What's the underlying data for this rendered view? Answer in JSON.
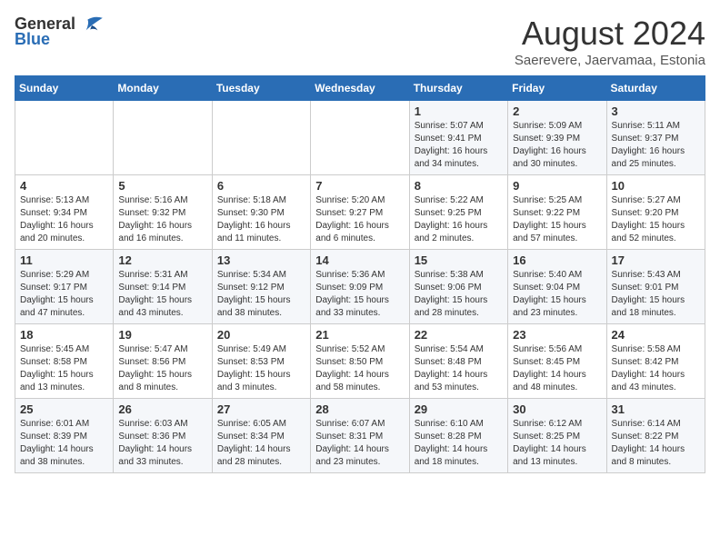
{
  "logo": {
    "general": "General",
    "blue": "Blue"
  },
  "title": {
    "month_year": "August 2024",
    "location": "Saerevere, Jaervamaa, Estonia"
  },
  "days_of_week": [
    "Sunday",
    "Monday",
    "Tuesday",
    "Wednesday",
    "Thursday",
    "Friday",
    "Saturday"
  ],
  "weeks": [
    [
      {
        "day": "",
        "info": ""
      },
      {
        "day": "",
        "info": ""
      },
      {
        "day": "",
        "info": ""
      },
      {
        "day": "",
        "info": ""
      },
      {
        "day": "1",
        "info": "Sunrise: 5:07 AM\nSunset: 9:41 PM\nDaylight: 16 hours\nand 34 minutes."
      },
      {
        "day": "2",
        "info": "Sunrise: 5:09 AM\nSunset: 9:39 PM\nDaylight: 16 hours\nand 30 minutes."
      },
      {
        "day": "3",
        "info": "Sunrise: 5:11 AM\nSunset: 9:37 PM\nDaylight: 16 hours\nand 25 minutes."
      }
    ],
    [
      {
        "day": "4",
        "info": "Sunrise: 5:13 AM\nSunset: 9:34 PM\nDaylight: 16 hours\nand 20 minutes."
      },
      {
        "day": "5",
        "info": "Sunrise: 5:16 AM\nSunset: 9:32 PM\nDaylight: 16 hours\nand 16 minutes."
      },
      {
        "day": "6",
        "info": "Sunrise: 5:18 AM\nSunset: 9:30 PM\nDaylight: 16 hours\nand 11 minutes."
      },
      {
        "day": "7",
        "info": "Sunrise: 5:20 AM\nSunset: 9:27 PM\nDaylight: 16 hours\nand 6 minutes."
      },
      {
        "day": "8",
        "info": "Sunrise: 5:22 AM\nSunset: 9:25 PM\nDaylight: 16 hours\nand 2 minutes."
      },
      {
        "day": "9",
        "info": "Sunrise: 5:25 AM\nSunset: 9:22 PM\nDaylight: 15 hours\nand 57 minutes."
      },
      {
        "day": "10",
        "info": "Sunrise: 5:27 AM\nSunset: 9:20 PM\nDaylight: 15 hours\nand 52 minutes."
      }
    ],
    [
      {
        "day": "11",
        "info": "Sunrise: 5:29 AM\nSunset: 9:17 PM\nDaylight: 15 hours\nand 47 minutes."
      },
      {
        "day": "12",
        "info": "Sunrise: 5:31 AM\nSunset: 9:14 PM\nDaylight: 15 hours\nand 43 minutes."
      },
      {
        "day": "13",
        "info": "Sunrise: 5:34 AM\nSunset: 9:12 PM\nDaylight: 15 hours\nand 38 minutes."
      },
      {
        "day": "14",
        "info": "Sunrise: 5:36 AM\nSunset: 9:09 PM\nDaylight: 15 hours\nand 33 minutes."
      },
      {
        "day": "15",
        "info": "Sunrise: 5:38 AM\nSunset: 9:06 PM\nDaylight: 15 hours\nand 28 minutes."
      },
      {
        "day": "16",
        "info": "Sunrise: 5:40 AM\nSunset: 9:04 PM\nDaylight: 15 hours\nand 23 minutes."
      },
      {
        "day": "17",
        "info": "Sunrise: 5:43 AM\nSunset: 9:01 PM\nDaylight: 15 hours\nand 18 minutes."
      }
    ],
    [
      {
        "day": "18",
        "info": "Sunrise: 5:45 AM\nSunset: 8:58 PM\nDaylight: 15 hours\nand 13 minutes."
      },
      {
        "day": "19",
        "info": "Sunrise: 5:47 AM\nSunset: 8:56 PM\nDaylight: 15 hours\nand 8 minutes."
      },
      {
        "day": "20",
        "info": "Sunrise: 5:49 AM\nSunset: 8:53 PM\nDaylight: 15 hours\nand 3 minutes."
      },
      {
        "day": "21",
        "info": "Sunrise: 5:52 AM\nSunset: 8:50 PM\nDaylight: 14 hours\nand 58 minutes."
      },
      {
        "day": "22",
        "info": "Sunrise: 5:54 AM\nSunset: 8:48 PM\nDaylight: 14 hours\nand 53 minutes."
      },
      {
        "day": "23",
        "info": "Sunrise: 5:56 AM\nSunset: 8:45 PM\nDaylight: 14 hours\nand 48 minutes."
      },
      {
        "day": "24",
        "info": "Sunrise: 5:58 AM\nSunset: 8:42 PM\nDaylight: 14 hours\nand 43 minutes."
      }
    ],
    [
      {
        "day": "25",
        "info": "Sunrise: 6:01 AM\nSunset: 8:39 PM\nDaylight: 14 hours\nand 38 minutes."
      },
      {
        "day": "26",
        "info": "Sunrise: 6:03 AM\nSunset: 8:36 PM\nDaylight: 14 hours\nand 33 minutes."
      },
      {
        "day": "27",
        "info": "Sunrise: 6:05 AM\nSunset: 8:34 PM\nDaylight: 14 hours\nand 28 minutes."
      },
      {
        "day": "28",
        "info": "Sunrise: 6:07 AM\nSunset: 8:31 PM\nDaylight: 14 hours\nand 23 minutes."
      },
      {
        "day": "29",
        "info": "Sunrise: 6:10 AM\nSunset: 8:28 PM\nDaylight: 14 hours\nand 18 minutes."
      },
      {
        "day": "30",
        "info": "Sunrise: 6:12 AM\nSunset: 8:25 PM\nDaylight: 14 hours\nand 13 minutes."
      },
      {
        "day": "31",
        "info": "Sunrise: 6:14 AM\nSunset: 8:22 PM\nDaylight: 14 hours\nand 8 minutes."
      }
    ]
  ]
}
